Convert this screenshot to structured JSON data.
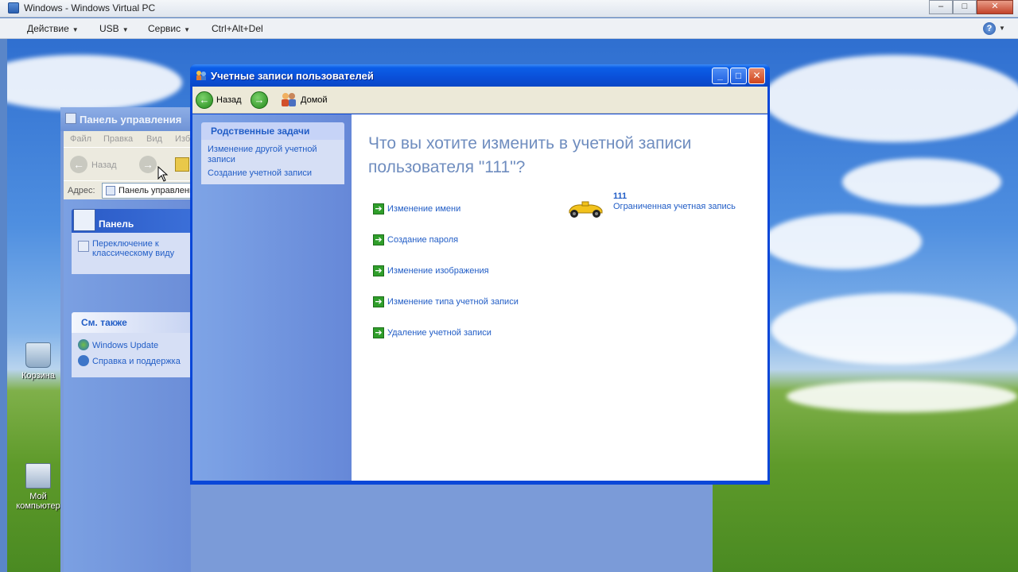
{
  "host": {
    "title": "Windows - Windows Virtual PC",
    "menu": [
      {
        "label": "Действие"
      },
      {
        "label": "USB"
      },
      {
        "label": "Сервис"
      },
      {
        "label": "Ctrl+Alt+Del"
      }
    ],
    "controls": {
      "minimize": "–",
      "maximize": "□",
      "close": "✕"
    },
    "help_glyph": "?"
  },
  "desktop": {
    "icons": [
      {
        "label": "Корзина",
        "icon": "recycle-bin-icon"
      },
      {
        "label": "Мой компьютер",
        "icon": "my-computer-icon"
      }
    ]
  },
  "control_panel": {
    "title": "Панель управления",
    "menu": [
      "Файл",
      "Правка",
      "Вид",
      "Избранное"
    ],
    "back_label": "Назад",
    "address_label": "Адрес:",
    "address_value": "Панель управления",
    "panel_title": "Панель управления",
    "switch_view": "Переключение к классическому виду",
    "see_also_title": "См. также",
    "see_also": [
      "Windows Update",
      "Справка и поддержка"
    ]
  },
  "user_accounts": {
    "title": "Учетные записи пользователей",
    "controls": {
      "minimize": "_",
      "maximize": "□",
      "close": "✕"
    },
    "toolbar": {
      "back": "Назад",
      "home": "Домой"
    },
    "related_tasks": {
      "title": "Родственные задачи",
      "items": [
        "Изменение другой учетной записи",
        "Создание учетной записи"
      ]
    },
    "question": "Что вы хотите изменить в учетной записи пользователя \"111\"?",
    "tasks": [
      "Изменение имени",
      "Создание пароля",
      "Изменение изображения",
      "Изменение типа учетной записи",
      "Удаление учетной записи"
    ],
    "user": {
      "name": "111",
      "type": "Ограниченная учетная запись"
    }
  }
}
